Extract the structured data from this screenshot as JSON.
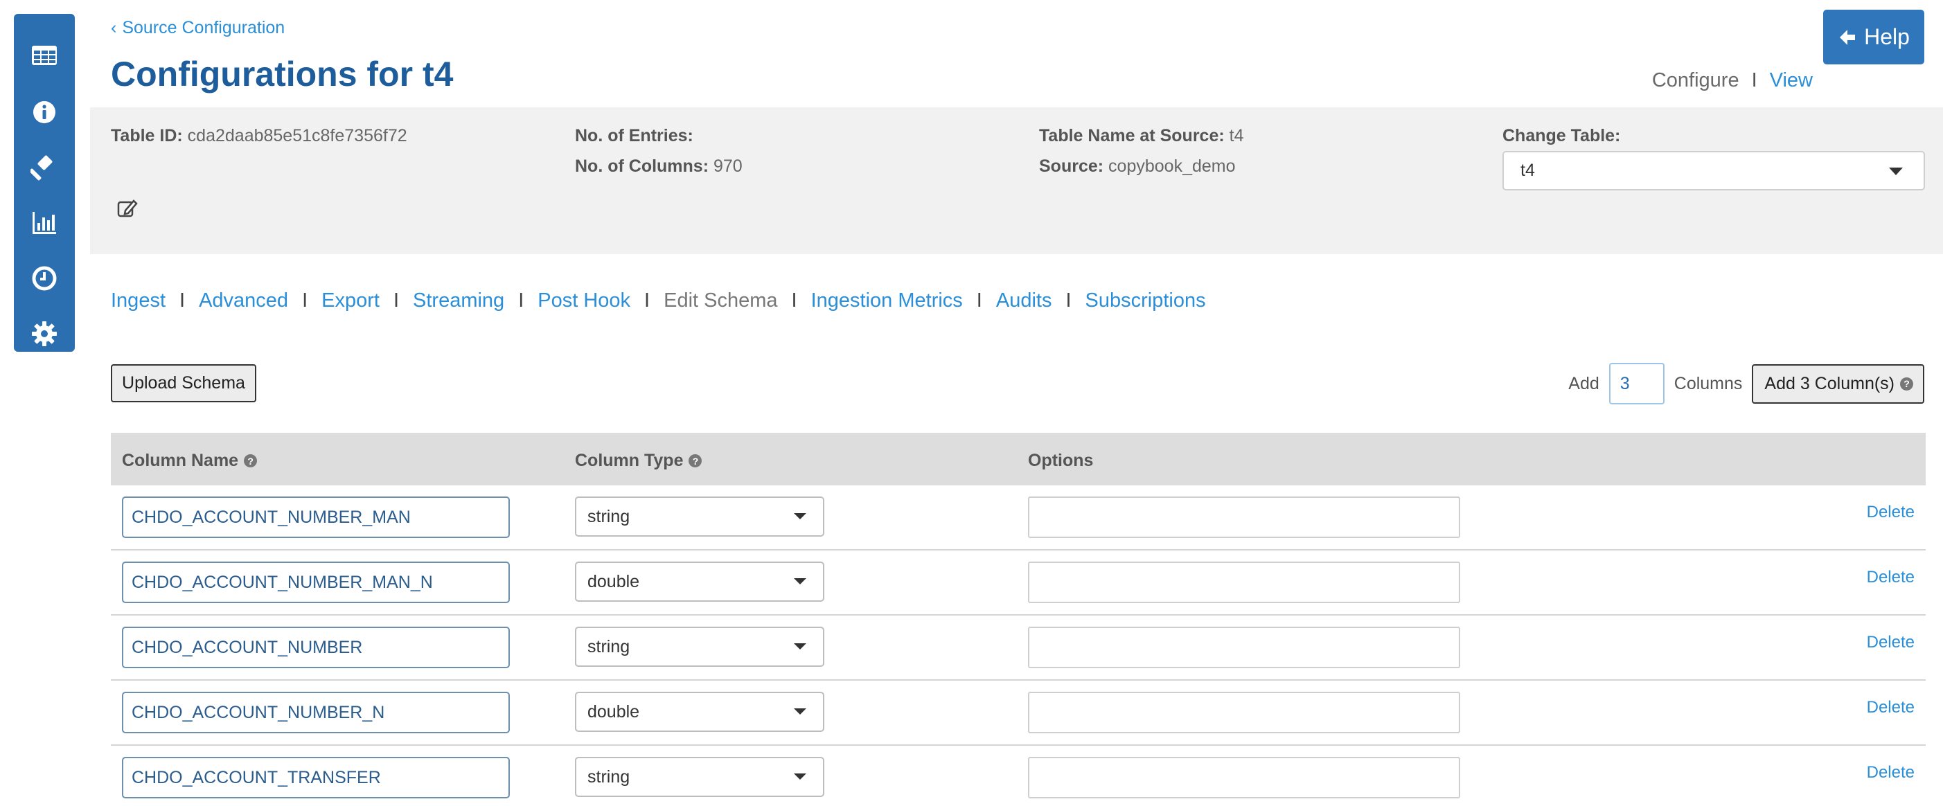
{
  "sidebar": {
    "items": [
      {
        "icon": "table-icon"
      },
      {
        "icon": "info-icon"
      },
      {
        "icon": "gavel-icon"
      },
      {
        "icon": "bar-chart-icon"
      },
      {
        "icon": "clock-icon"
      },
      {
        "icon": "gear-icon"
      }
    ]
  },
  "header": {
    "breadcrumb": {
      "arrow": "‹",
      "label": "Source Configuration"
    },
    "title": "Configurations for t4",
    "help_label": "Help",
    "view_toggle": {
      "configure": "Configure",
      "separator": "I",
      "view": "View"
    }
  },
  "info": {
    "table_id_label": "Table ID:",
    "table_id_value": "cda2daab85e51c8fe7356f72",
    "entries_label": "No. of Entries:",
    "entries_value": "",
    "columns_label": "No. of Columns:",
    "columns_value": "970",
    "table_name_label": "Table Name at Source:",
    "table_name_value": "t4",
    "source_label": "Source:",
    "source_value": "copybook_demo",
    "change_table_label": "Change Table:",
    "change_table_value": "t4"
  },
  "tabs": {
    "separator": "I",
    "items": [
      {
        "label": "Ingest"
      },
      {
        "label": "Advanced"
      },
      {
        "label": "Export"
      },
      {
        "label": "Streaming"
      },
      {
        "label": "Post Hook"
      },
      {
        "label": "Edit Schema"
      },
      {
        "label": "Ingestion Metrics"
      },
      {
        "label": "Audits"
      },
      {
        "label": "Subscriptions"
      }
    ]
  },
  "toolbar": {
    "upload_label": "Upload Schema",
    "add_label": "Add",
    "add_count": "3",
    "columns_label": "Columns",
    "add_button_label": "Add 3 Column(s)"
  },
  "table": {
    "headers": {
      "name": "Column Name",
      "type": "Column Type",
      "options": "Options"
    },
    "delete_label": "Delete",
    "rows": [
      {
        "name": "CHDO_ACCOUNT_NUMBER_MAN",
        "type": "string"
      },
      {
        "name": "CHDO_ACCOUNT_NUMBER_MAN_N",
        "type": "double"
      },
      {
        "name": "CHDO_ACCOUNT_NUMBER",
        "type": "string"
      },
      {
        "name": "CHDO_ACCOUNT_NUMBER_N",
        "type": "double"
      },
      {
        "name": "CHDO_ACCOUNT_TRANSFER",
        "type": "string"
      }
    ]
  },
  "colors": {
    "sidebar": "#2c6fb0",
    "title": "#1d5d9b",
    "link": "#2a8fd8",
    "help_button": "#3076bb"
  }
}
